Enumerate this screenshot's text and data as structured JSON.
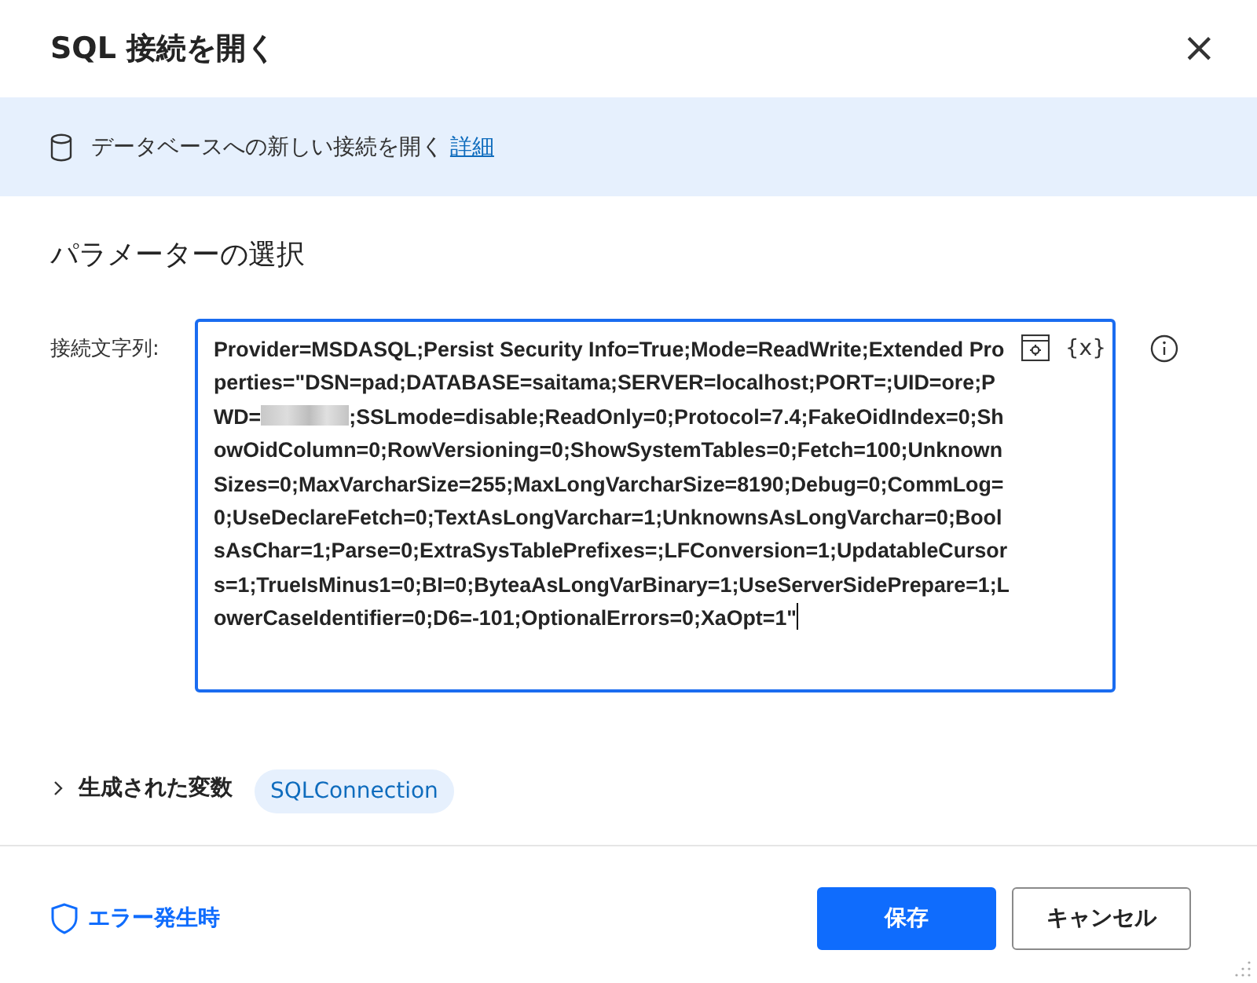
{
  "window": {
    "title": "SQL 接続を開く",
    "close": "×"
  },
  "info_bar": {
    "text": "データベースへの新しい接続を開く",
    "link": "詳細"
  },
  "section": {
    "title": "パラメーターの選択"
  },
  "connection_string": {
    "label": "接続文字列:",
    "value_before_redaction": "Provider=MSDASQL;Persist Security Info=True;Mode=ReadWrite;Extended Properties=\"DSN=pad;DATABASE=saitama;SERVER=localhost;PORT=;UID=ore;PWD=",
    "value_after_redaction": ";SSLmode=disable;ReadOnly=0;Protocol=7.4;FakeOidIndex=0;ShowOidColumn=0;RowVersioning=0;ShowSystemTables=0;Fetch=100;UnknownSizes=0;MaxVarcharSize=255;MaxLongVarcharSize=8190;Debug=0;CommLog=0;UseDeclareFetch=0;TextAsLongVarchar=1;UnknownsAsLongVarchar=0;BoolsAsChar=1;Parse=0;ExtraSysTablePrefixes=;LFConversion=1;UpdatableCursors=1;TrueIsMinus1=0;BI=0;ByteaAsLongVarBinary=1;UseServerSidePrepare=1;LowerCaseIdentifier=0;D6=-101;OptionalErrors=0;XaOpt=1\"",
    "variable_button": "{x}"
  },
  "variables": {
    "label": "生成された変数",
    "expanded": false,
    "chips": [
      "SQLConnection"
    ]
  },
  "footer": {
    "error_link": "エラー発生時",
    "buttons": [
      {
        "label": "保存",
        "kind": "primary"
      },
      {
        "label": "キャンセル",
        "kind": "secondary"
      }
    ]
  }
}
